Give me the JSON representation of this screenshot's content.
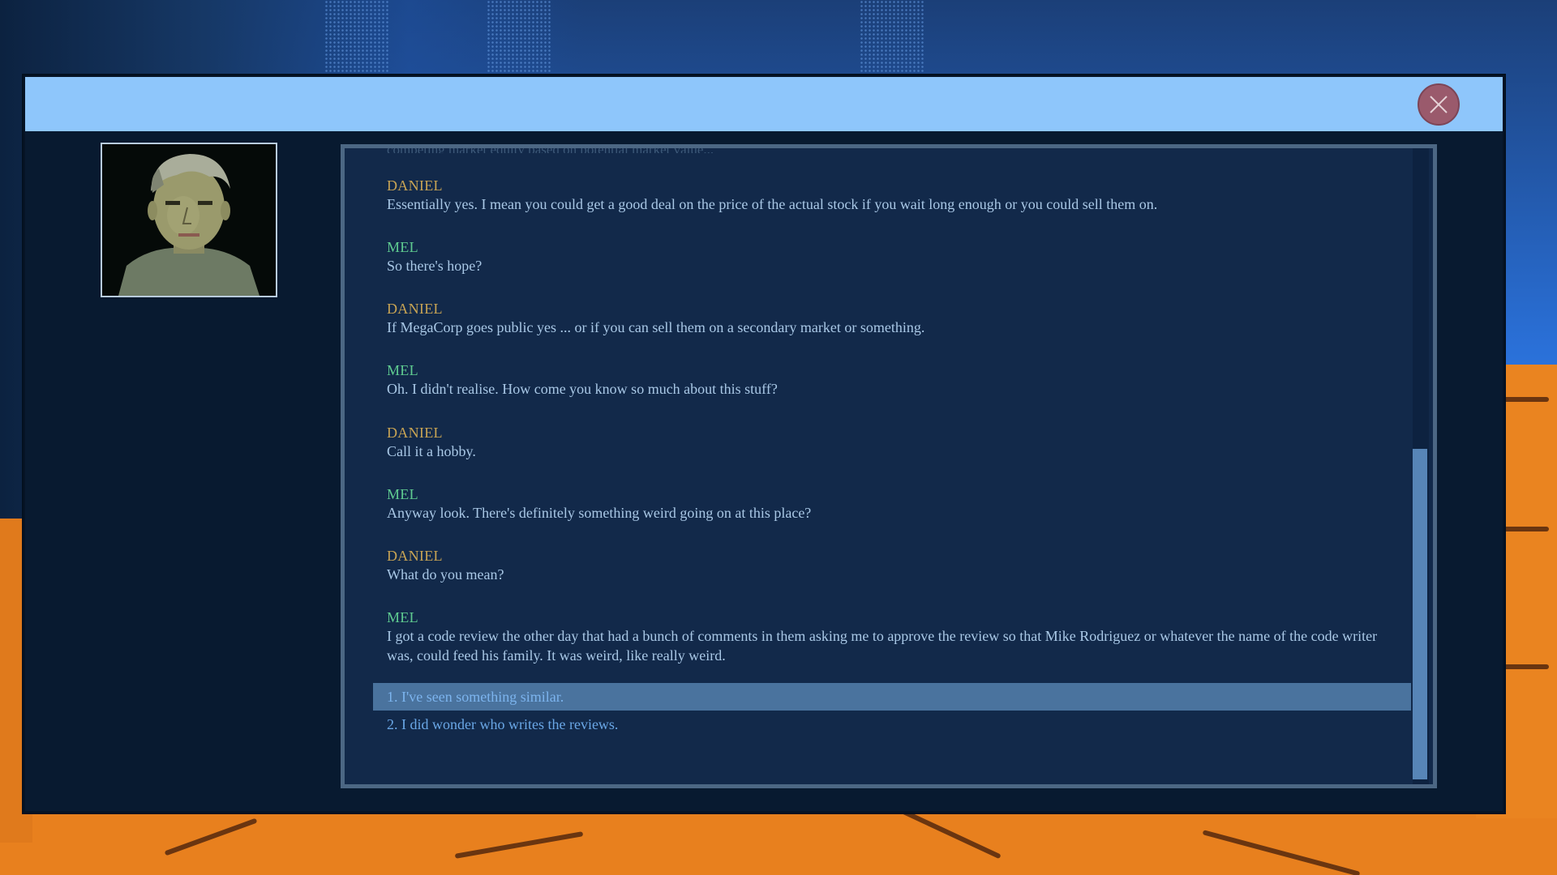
{
  "background": {
    "sky_color": "#3f92f2",
    "desert_color": "#e8801e"
  },
  "window": {
    "title_bar_color": "#8ec6fb",
    "close_icon": "close-icon"
  },
  "portrait": {
    "subject": "portrait-icon"
  },
  "conversation": {
    "faded_line": "competing market equity based on potential market value...",
    "entries": [
      {
        "speaker": "DANIEL",
        "text": "Essentially yes. I mean you could get a good deal on the price of the actual stock if you wait long enough or you could sell them on."
      },
      {
        "speaker": "MEL",
        "text": "So there's hope?"
      },
      {
        "speaker": "DANIEL",
        "text": "If MegaCorp goes public yes ... or if you can sell them on a secondary market or something."
      },
      {
        "speaker": "MEL",
        "text": "Oh. I didn't realise. How come you know so much about this stuff?"
      },
      {
        "speaker": "DANIEL",
        "text": "Call it a hobby."
      },
      {
        "speaker": "MEL",
        "text": "Anyway look. There's definitely something weird going on at this place?"
      },
      {
        "speaker": "DANIEL",
        "text": "What do you mean?"
      },
      {
        "speaker": "MEL",
        "text": "I got a code review the other day that had a bunch of comments in them asking me to approve the review so that Mike Rodriguez or whatever the name of the code writer was, could feed his family. It was weird, like really weird."
      }
    ],
    "choices": [
      {
        "label": "1. I've seen something similar.",
        "selected": true
      },
      {
        "label": "2. I did wonder who writes the reviews.",
        "selected": false
      }
    ],
    "speaker_colors": {
      "DANIEL": "#c8a454",
      "MEL": "#5fcb90"
    }
  }
}
